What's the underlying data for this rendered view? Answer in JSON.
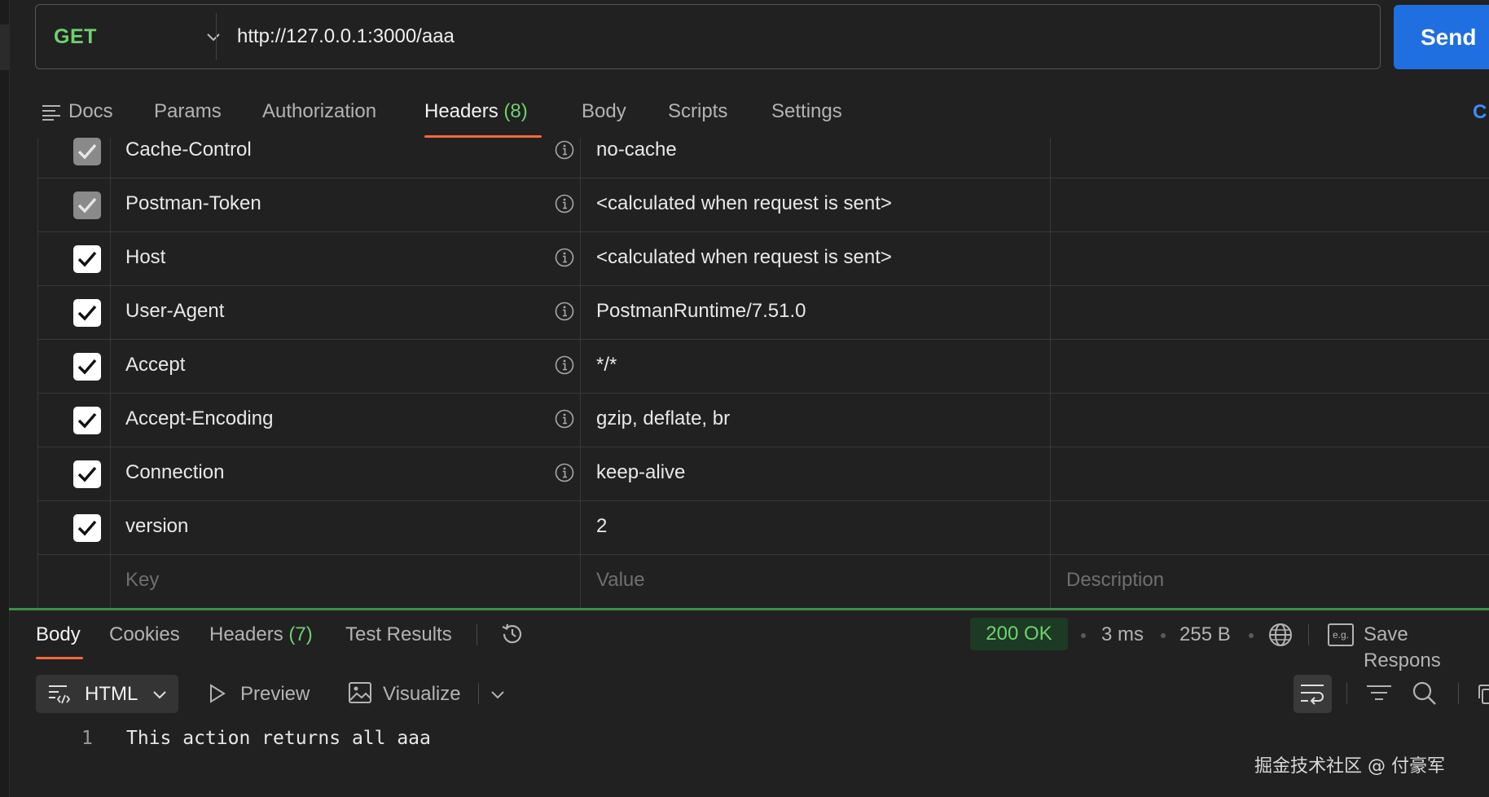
{
  "request": {
    "method": "GET",
    "url": "http://127.0.0.1:3000/aaa",
    "send_label": "Send"
  },
  "request_tabs": {
    "docs": "Docs",
    "params": "Params",
    "authorization": "Authorization",
    "headers": "Headers",
    "headers_count": "(8)",
    "body": "Body",
    "scripts": "Scripts",
    "settings": "Settings",
    "cookies_partial": "C"
  },
  "headers_table": {
    "rows": [
      {
        "key": "Cache-Control",
        "value": "no-cache",
        "checked": true,
        "disabled": true,
        "info": true
      },
      {
        "key": "Postman-Token",
        "value": "<calculated when request is sent>",
        "checked": true,
        "disabled": true,
        "info": true
      },
      {
        "key": "Host",
        "value": "<calculated when request is sent>",
        "checked": true,
        "disabled": false,
        "info": true
      },
      {
        "key": "User-Agent",
        "value": "PostmanRuntime/7.51.0",
        "checked": true,
        "disabled": false,
        "info": true
      },
      {
        "key": "Accept",
        "value": "*/*",
        "checked": true,
        "disabled": false,
        "info": true
      },
      {
        "key": "Accept-Encoding",
        "value": "gzip, deflate, br",
        "checked": true,
        "disabled": false,
        "info": true
      },
      {
        "key": "Connection",
        "value": "keep-alive",
        "checked": true,
        "disabled": false,
        "info": true
      },
      {
        "key": "version",
        "value": "2",
        "checked": true,
        "disabled": false,
        "info": false
      }
    ],
    "placeholder_key": "Key",
    "placeholder_value": "Value",
    "placeholder_description": "Description"
  },
  "response_tabs": {
    "body": "Body",
    "cookies": "Cookies",
    "headers": "Headers",
    "headers_count": "(7)",
    "test_results": "Test Results"
  },
  "response_meta": {
    "status": "200 OK",
    "time": "3 ms",
    "size": "255 B",
    "save_response": "Save Respons",
    "eg_badge": "e.g."
  },
  "response_toolbar": {
    "format": "HTML",
    "preview": "Preview",
    "visualize": "Visualize"
  },
  "response_body": {
    "line_number": "1",
    "line_text": "This action returns all aaa"
  },
  "watermark": "掘金技术社区 @ 付豪军",
  "colors": {
    "accent_green": "#6ed26e",
    "send_blue": "#1f6fe0",
    "tab_underline": "#f26b3a",
    "background": "#212121"
  }
}
